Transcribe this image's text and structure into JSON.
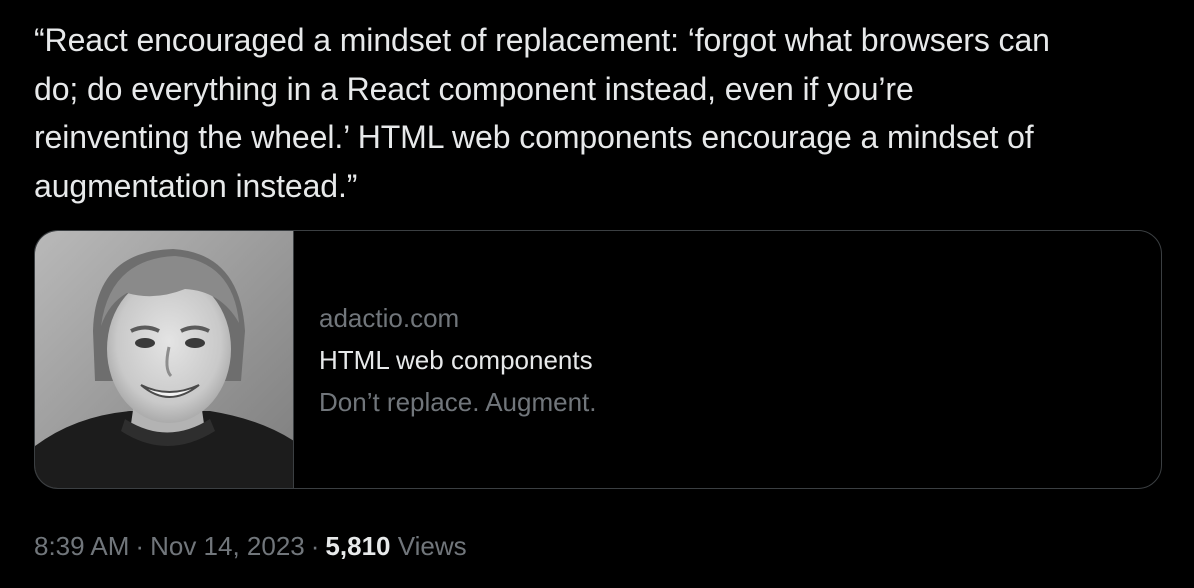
{
  "tweet": {
    "lines": [
      "“React encouraged a mindset of replacement: ‘forgot what browsers can",
      "do; do everything in a React component instead, even if you’re",
      "reinventing the wheel.’ HTML web components encourage a mindset of",
      "augmentation instead.”"
    ]
  },
  "link_card": {
    "image_icon": "author-photo",
    "domain": "adactio.com",
    "title": "HTML web components",
    "description": "Don’t replace. Augment."
  },
  "meta": {
    "time": "8:39 AM",
    "separator": "·",
    "date": "Nov 14, 2023",
    "views_count": "5,810",
    "views_label": "Views"
  },
  "colors": {
    "background": "#000000",
    "text_primary": "#e7e9ea",
    "text_secondary": "#71767b",
    "card_border": "#3b3f42"
  }
}
